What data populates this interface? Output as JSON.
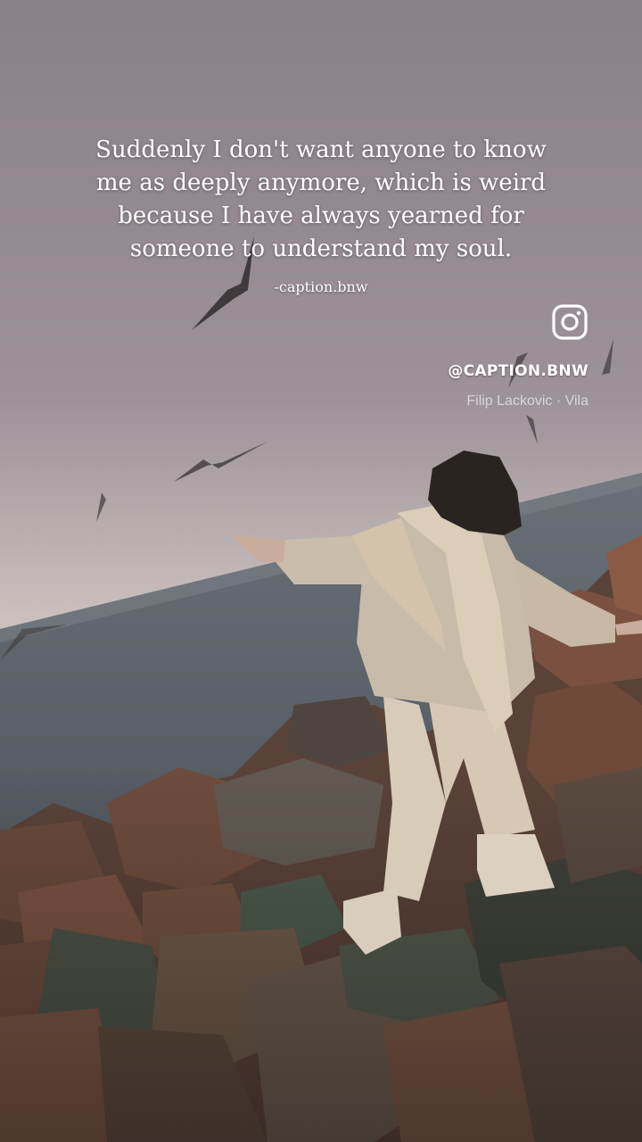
{
  "story": {
    "quote_lines": [
      "Suddenly I don't want anyone to know",
      "me as deeply anymore, which is weird",
      "because I have always yearned for",
      "someone to understand my soul."
    ],
    "credit": "-caption.bnw",
    "instagram_icon": "instagram-icon",
    "handle": "@CAPTION.BNW",
    "music": "Filip Lackovic · Vila"
  },
  "colors": {
    "sky_top": "#8d8389",
    "sky_horizon": "#d9cfcb",
    "sea": "#5f666d",
    "rocks": "#6a4c3f",
    "text": "#ffffff"
  }
}
